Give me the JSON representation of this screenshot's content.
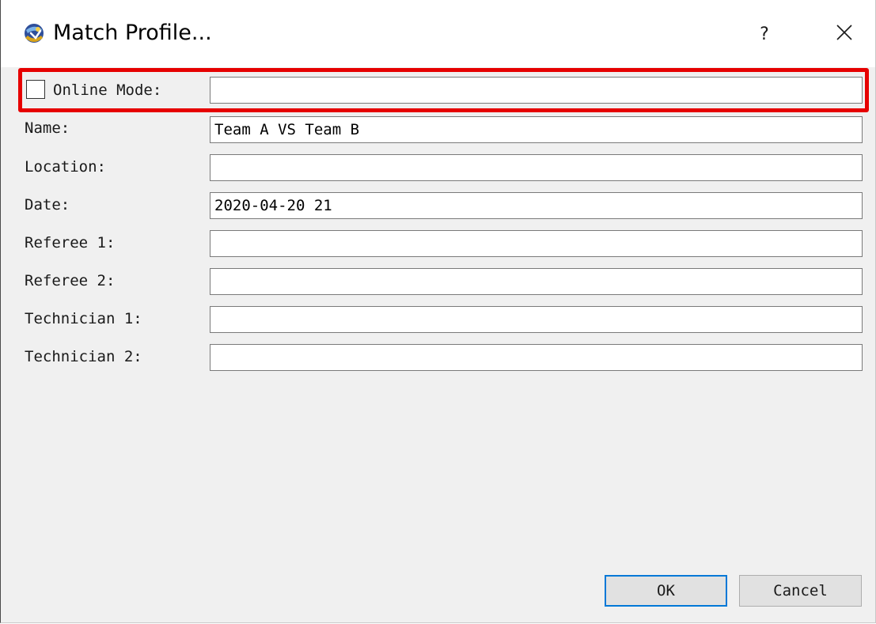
{
  "dialog": {
    "title": "Match Profile...",
    "help_label": "?",
    "icons": {
      "app": "app-logo-icon",
      "close": "close-icon"
    }
  },
  "online_mode": {
    "label": "Online Mode:",
    "checked": false,
    "value": ""
  },
  "fields": {
    "name": {
      "label": "Name:",
      "value": "Team A VS Team B"
    },
    "location": {
      "label": "Location:",
      "value": ""
    },
    "date": {
      "label": "Date:",
      "value": "2020-04-20 21"
    },
    "referee1": {
      "label": "Referee 1:",
      "value": ""
    },
    "referee2": {
      "label": "Referee 2:",
      "value": ""
    },
    "technician1": {
      "label": "Technician 1:",
      "value": ""
    },
    "technician2": {
      "label": "Technician 2:",
      "value": ""
    }
  },
  "buttons": {
    "ok": "OK",
    "cancel": "Cancel"
  },
  "colors": {
    "highlight": "#e60000",
    "focus_border": "#0078d7",
    "background": "#f0f0f0"
  }
}
